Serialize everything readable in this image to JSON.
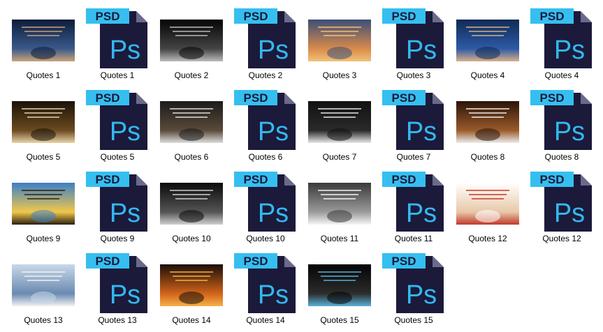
{
  "explorer": {
    "items": [
      {
        "label": "Quotes 1",
        "type": "image",
        "palette": [
          "#0c1c3a",
          "#3a5a8a",
          "#c9a27a"
        ]
      },
      {
        "label": "Quotes 1",
        "type": "psd"
      },
      {
        "label": "Quotes 2",
        "type": "image",
        "palette": [
          "#050505",
          "#444444",
          "#bbbbbb"
        ]
      },
      {
        "label": "Quotes 2",
        "type": "psd"
      },
      {
        "label": "Quotes 3",
        "type": "image",
        "palette": [
          "#3b4e78",
          "#d98b4a",
          "#f2c27a"
        ]
      },
      {
        "label": "Quotes 3",
        "type": "psd"
      },
      {
        "label": "Quotes 4",
        "type": "image",
        "palette": [
          "#0f2a55",
          "#2e5aa6",
          "#d8b08a"
        ]
      },
      {
        "label": "Quotes 4",
        "type": "psd"
      },
      {
        "label": "Quotes 5",
        "type": "image",
        "palette": [
          "#1a1208",
          "#6b4a20",
          "#e8d3a8"
        ]
      },
      {
        "label": "Quotes 5",
        "type": "psd"
      },
      {
        "label": "Quotes 6",
        "type": "image",
        "palette": [
          "#1b1b1b",
          "#5a4a3a",
          "#dddddd"
        ]
      },
      {
        "label": "Quotes 6",
        "type": "psd"
      },
      {
        "label": "Quotes 7",
        "type": "image",
        "palette": [
          "#111111",
          "#2a2a2a",
          "#e8e8e8"
        ]
      },
      {
        "label": "Quotes 7",
        "type": "psd"
      },
      {
        "label": "Quotes 8",
        "type": "image",
        "palette": [
          "#2b1408",
          "#9a5a2a",
          "#ececec"
        ]
      },
      {
        "label": "Quotes 8",
        "type": "psd"
      },
      {
        "label": "Quotes 9",
        "type": "image",
        "palette": [
          "#3a7fc9",
          "#f2c84a",
          "#2a2010"
        ]
      },
      {
        "label": "Quotes 9",
        "type": "psd"
      },
      {
        "label": "Quotes 10",
        "type": "image",
        "palette": [
          "#0a0a0a",
          "#555555",
          "#d0d0d0"
        ]
      },
      {
        "label": "Quotes 10",
        "type": "psd"
      },
      {
        "label": "Quotes 11",
        "type": "image",
        "palette": [
          "#3a3a3a",
          "#9a9a9a",
          "#f5f5f5"
        ]
      },
      {
        "label": "Quotes 11",
        "type": "psd"
      },
      {
        "label": "Quotes 12",
        "type": "image",
        "palette": [
          "#ffffff",
          "#e8c8a8",
          "#c0392b"
        ]
      },
      {
        "label": "Quotes 12",
        "type": "psd"
      },
      {
        "label": "Quotes 13",
        "type": "image",
        "palette": [
          "#c8d8ea",
          "#6a8ab0",
          "#f2f2f2"
        ]
      },
      {
        "label": "Quotes 13",
        "type": "psd"
      },
      {
        "label": "Quotes 14",
        "type": "image",
        "palette": [
          "#1a0e08",
          "#d0641a",
          "#f7b04a"
        ]
      },
      {
        "label": "Quotes 14",
        "type": "psd"
      },
      {
        "label": "Quotes 15",
        "type": "image",
        "palette": [
          "#050505",
          "#2c2c2c",
          "#5ab0d8"
        ]
      },
      {
        "label": "Quotes 15",
        "type": "psd"
      }
    ]
  },
  "psd_icon": {
    "badge_text": "PSD",
    "logo_text": "Ps",
    "badge_color": "#35bff0",
    "page_color": "#1b1a3a",
    "logo_color": "#33b8f0"
  }
}
